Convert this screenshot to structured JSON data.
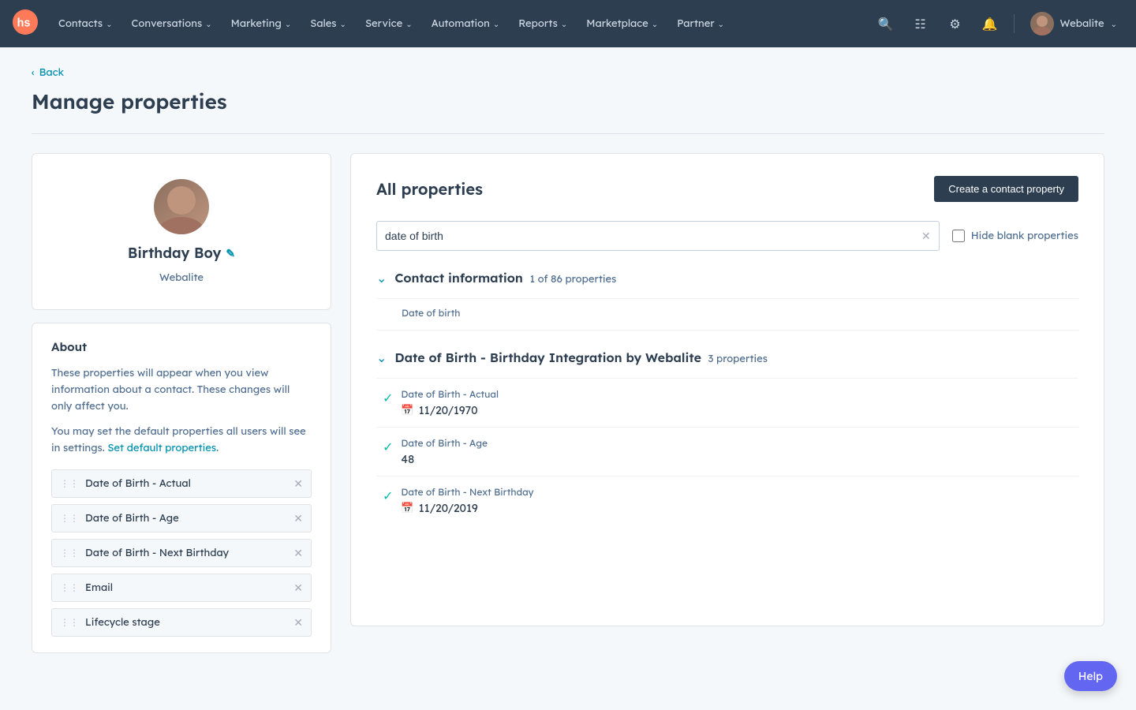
{
  "navbar": {
    "logo": "hubspot-logo",
    "items": [
      {
        "label": "Contacts",
        "id": "contacts"
      },
      {
        "label": "Conversations",
        "id": "conversations"
      },
      {
        "label": "Marketing",
        "id": "marketing"
      },
      {
        "label": "Sales",
        "id": "sales"
      },
      {
        "label": "Service",
        "id": "service"
      },
      {
        "label": "Automation",
        "id": "automation"
      },
      {
        "label": "Reports",
        "id": "reports"
      },
      {
        "label": "Marketplace",
        "id": "marketplace"
      },
      {
        "label": "Partner",
        "id": "partner"
      }
    ],
    "user": {
      "name": "Webalite"
    }
  },
  "page": {
    "back_label": "Back",
    "title": "Manage properties"
  },
  "profile": {
    "name": "Birthday Boy",
    "company": "Webalite"
  },
  "about": {
    "title": "About",
    "text1": "These properties will appear when you view information about a contact. These changes will only affect you.",
    "text2": "You may set the default properties all users will see in settings.",
    "link_label": "Set default properties"
  },
  "property_list": [
    {
      "label": "Date of Birth - Actual",
      "id": "dob-actual"
    },
    {
      "label": "Date of Birth - Age",
      "id": "dob-age"
    },
    {
      "label": "Date of Birth - Next Birthday",
      "id": "dob-next"
    },
    {
      "label": "Email",
      "id": "email"
    },
    {
      "label": "Lifecycle stage",
      "id": "lifecycle"
    }
  ],
  "right_panel": {
    "title": "All properties",
    "create_btn": "Create a contact property",
    "search": {
      "value": "date of birth",
      "placeholder": "Search properties"
    },
    "hide_blank": {
      "label": "Hide blank properties",
      "checked": false
    },
    "sections": [
      {
        "id": "contact-info",
        "title": "Contact information",
        "count": "1 of 86 properties",
        "expanded": true,
        "properties": [
          {
            "label": "Date of birth",
            "value": "",
            "has_check": false,
            "icon": ""
          }
        ]
      },
      {
        "id": "dob-integration",
        "title": "Date of Birth - Birthday Integration by Webalite",
        "count": "3 properties",
        "expanded": true,
        "properties": [
          {
            "label": "Date of Birth - Actual",
            "value": "11/20/1970",
            "has_check": true,
            "icon": "calendar"
          },
          {
            "label": "Date of Birth - Age",
            "value": "48",
            "has_check": true,
            "icon": ""
          },
          {
            "label": "Date of Birth - Next Birthday",
            "value": "11/20/2019",
            "has_check": true,
            "icon": "calendar"
          }
        ]
      }
    ]
  },
  "help": {
    "label": "Help"
  }
}
